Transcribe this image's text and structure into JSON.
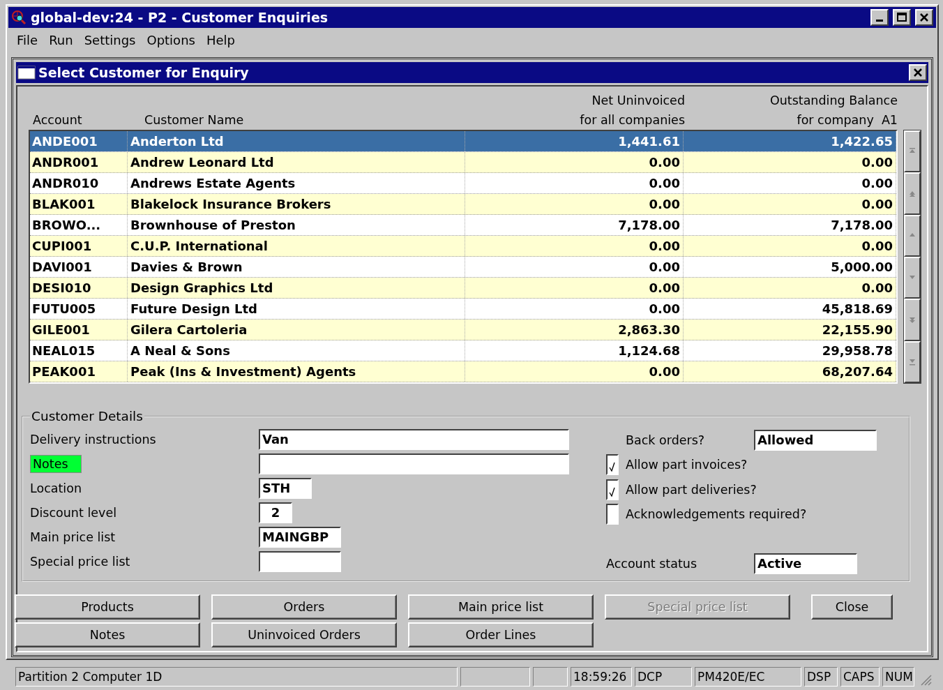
{
  "window": {
    "title": "global-dev:24 - P2 - Customer Enquiries"
  },
  "menu": [
    "File",
    "Run",
    "Settings",
    "Options",
    "Help"
  ],
  "dialog": {
    "title": "Select Customer for Enquiry"
  },
  "table": {
    "columns": [
      {
        "lines": [
          "Account"
        ]
      },
      {
        "lines": [
          "Customer Name"
        ]
      },
      {
        "lines": [
          "Net Uninvoiced",
          "for all companies"
        ]
      },
      {
        "lines": [
          "Outstanding Balance",
          "for company  A1"
        ]
      }
    ],
    "rows": [
      {
        "account": "ANDE001",
        "name": "Anderton Ltd",
        "net": "1,441.61",
        "outstanding": "1,422.65",
        "selected": true
      },
      {
        "account": "ANDR001",
        "name": "Andrew Leonard Ltd",
        "net": "0.00",
        "outstanding": "0.00",
        "selected": false
      },
      {
        "account": "ANDR010",
        "name": "Andrews Estate Agents",
        "net": "0.00",
        "outstanding": "0.00",
        "selected": false
      },
      {
        "account": "BLAK001",
        "name": "Blakelock Insurance Brokers",
        "net": "0.00",
        "outstanding": "0.00",
        "selected": false
      },
      {
        "account": "BROWO...",
        "name": "Brownhouse of Preston",
        "net": "7,178.00",
        "outstanding": "7,178.00",
        "selected": false
      },
      {
        "account": "CUPI001",
        "name": "C.U.P. International",
        "net": "0.00",
        "outstanding": "0.00",
        "selected": false
      },
      {
        "account": "DAVI001",
        "name": "Davies & Brown",
        "net": "0.00",
        "outstanding": "5,000.00",
        "selected": false
      },
      {
        "account": "DESI010",
        "name": "Design Graphics Ltd",
        "net": "0.00",
        "outstanding": "0.00",
        "selected": false
      },
      {
        "account": "FUTU005",
        "name": "Future Design Ltd",
        "net": "0.00",
        "outstanding": "45,818.69",
        "selected": false
      },
      {
        "account": "GILE001",
        "name": "Gilera Cartoleria",
        "net": "2,863.30",
        "outstanding": "22,155.90",
        "selected": false
      },
      {
        "account": "NEAL015",
        "name": "A Neal & Sons",
        "net": "1,124.68",
        "outstanding": "29,958.78",
        "selected": false
      },
      {
        "account": "PEAK001",
        "name": "Peak (Ins & Investment) Agents",
        "net": "0.00",
        "outstanding": "68,207.64",
        "selected": false
      }
    ]
  },
  "details": {
    "title": "Customer Details",
    "fields": [
      {
        "label": "Delivery instructions",
        "value": "Van",
        "highlighted": false
      },
      {
        "label": "Notes",
        "highlighted": true
      },
      {
        "label": "Location",
        "value": "STH",
        "highlighted": false
      },
      {
        "label": "Discount level",
        "value": "2",
        "highlighted": false
      },
      {
        "label": "Main price list",
        "value": "MAINGBP",
        "highlighted": false
      },
      {
        "label": "Special price list",
        "highlighted": false
      }
    ],
    "back_orders": {
      "label": "Back orders?",
      "value": "Allowed"
    },
    "checkboxes": [
      {
        "label": "Allow part invoices?",
        "checked": true
      },
      {
        "label": "Allow part deliveries?",
        "checked": true
      },
      {
        "label": "Acknowledgements required?",
        "checked": false
      }
    ],
    "account_status": {
      "label": "Account status",
      "value": "Active"
    }
  },
  "buttons": [
    [
      {
        "label": "Products",
        "disabled": false
      },
      {
        "label": "Orders",
        "disabled": false
      },
      {
        "label": "Main price list",
        "disabled": false
      },
      {
        "label": "Special price list",
        "disabled": true
      },
      {
        "label": "Close",
        "disabled": false
      }
    ],
    [
      {
        "label": "Notes",
        "disabled": false
      },
      {
        "label": "Uninvoiced Orders",
        "disabled": false
      },
      {
        "label": "Order Lines",
        "disabled": false
      }
    ]
  ],
  "status_bar": {
    "panes": [
      "Partition 2 Computer 1D",
      "18:59:26",
      "DCP",
      "PM420E/EC",
      "DSP",
      "CAPS",
      "NUM"
    ]
  }
}
